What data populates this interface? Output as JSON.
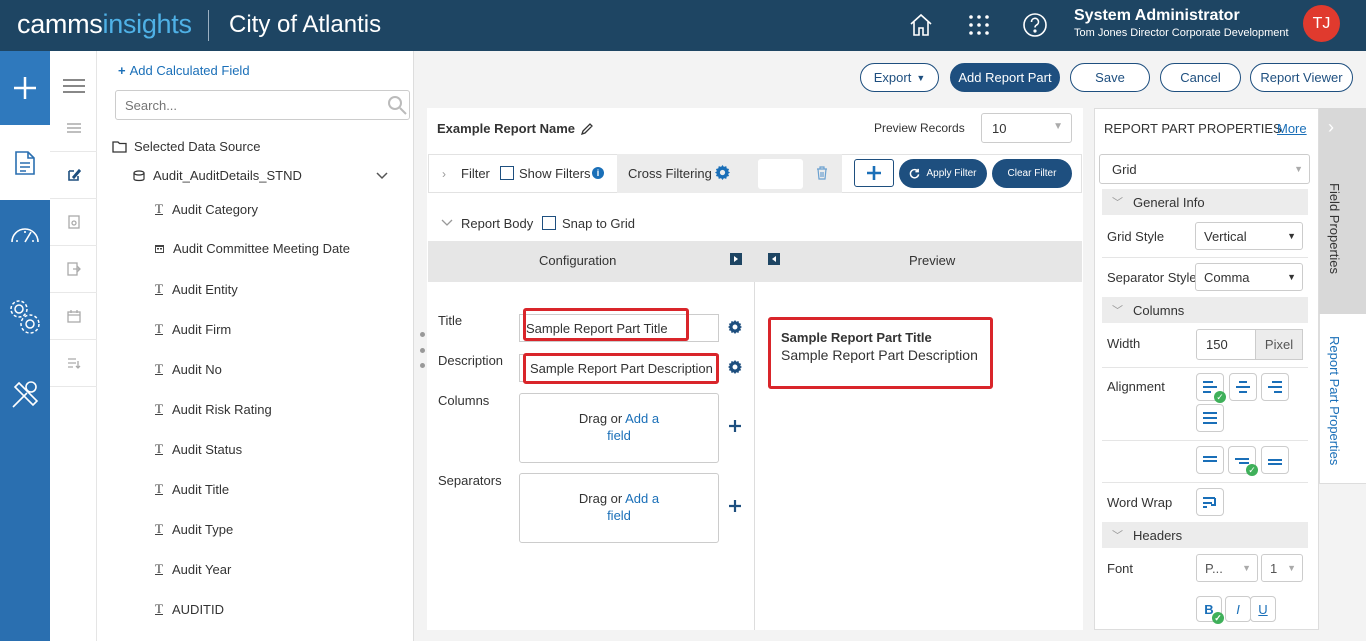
{
  "header": {
    "brand_part1": "camms",
    "brand_part2": "insights",
    "org": "City of Atlantis",
    "user_name": "System Administrator",
    "user_role": "Tom Jones Director Corporate Development",
    "avatar_initials": "TJ",
    "icons": [
      "home-icon",
      "apps-grid-icon",
      "help-icon"
    ]
  },
  "fields_panel": {
    "add_calculated": "Add Calculated Field",
    "search_placeholder": "Search...",
    "selected_data_source": "Selected Data Source",
    "data_source_name": "Audit_AuditDetails_STND",
    "fields": [
      {
        "label": "Audit Category",
        "type": "text"
      },
      {
        "label": "Audit Committee Meeting Date",
        "type": "date"
      },
      {
        "label": "Audit Entity",
        "type": "text"
      },
      {
        "label": "Audit Firm",
        "type": "text"
      },
      {
        "label": "Audit No",
        "type": "text"
      },
      {
        "label": "Audit Risk Rating",
        "type": "text"
      },
      {
        "label": "Audit Status",
        "type": "text"
      },
      {
        "label": "Audit Title",
        "type": "text"
      },
      {
        "label": "Audit Type",
        "type": "text"
      },
      {
        "label": "Audit Year",
        "type": "text"
      },
      {
        "label": "AUDITID",
        "type": "text"
      }
    ]
  },
  "toolbar": {
    "export": "Export",
    "add_report_part": "Add Report Part",
    "save": "Save",
    "cancel": "Cancel",
    "report_viewer": "Report Viewer"
  },
  "editor": {
    "report_name": "Example Report Name",
    "preview_records_label": "Preview Records",
    "preview_records_value": "10",
    "filter_label": "Filter",
    "show_filters": "Show Filters",
    "cross_filtering": "Cross Filtering",
    "apply_filter": "Apply Filter",
    "clear_filter": "Clear Filter",
    "report_body": "Report Body",
    "snap_to_grid": "Snap to Grid",
    "configuration": "Configuration",
    "preview": "Preview",
    "title_label": "Title",
    "title_value": "Sample Report Part Title",
    "description_label": "Description",
    "description_value": "Sample Report Part Description",
    "columns_label": "Columns",
    "separators_label": "Separators",
    "drag_or": "Drag or",
    "add_a": "Add a",
    "field": "field",
    "preview_title": "Sample Report Part Title",
    "preview_description": "Sample Report Part Description"
  },
  "properties": {
    "header": "REPORT PART PROPERTIES",
    "more": "More",
    "part_type": "Grid",
    "general_info": "General Info",
    "grid_style_label": "Grid Style",
    "grid_style_value": "Vertical",
    "separator_style_label": "Separator Style",
    "separator_style_value": "Comma",
    "columns_section": "Columns",
    "width_label": "Width",
    "width_value": "150",
    "width_unit": "Pixel",
    "alignment_label": "Alignment",
    "word_wrap_label": "Word Wrap",
    "headers_section": "Headers",
    "font_label": "Font",
    "font_value": "P...",
    "font_size_value": "1",
    "bold": "B",
    "italic": "I",
    "underline": "U",
    "tab_field_properties": "Field Properties",
    "tab_report_part_properties": "Report Part Properties"
  },
  "colors": {
    "header_bg": "#1e4563",
    "rail_bg": "#2a6fb0",
    "primary": "#1e4f7f",
    "link": "#1a6fb8",
    "highlight_red": "#d9252a",
    "avatar": "#e03a2e"
  }
}
